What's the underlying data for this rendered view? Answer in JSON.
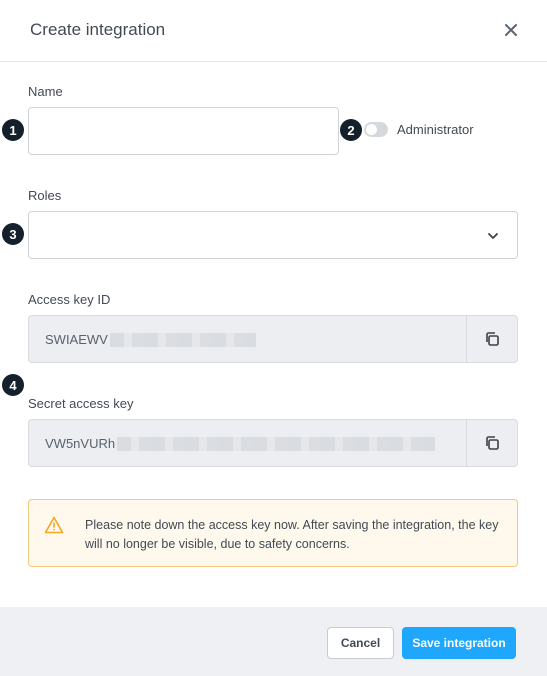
{
  "dialog": {
    "title": "Create integration"
  },
  "fields": {
    "name_label": "Name",
    "name_value": "",
    "admin_label": "Administrator",
    "admin_enabled": false,
    "roles_label": "Roles",
    "roles_value": "",
    "access_key_label": "Access key ID",
    "access_key_value": "SWIAEWV",
    "secret_key_label": "Secret access key",
    "secret_key_value": "VW5nVURh"
  },
  "badges": [
    "1",
    "2",
    "3",
    "4"
  ],
  "warning": {
    "text": "Please note down the access key now. After saving the integration, the key will no longer be visible, due to safety concerns.",
    "icon": "warning-triangle-icon",
    "color": "#f5a623"
  },
  "footer": {
    "cancel_label": "Cancel",
    "save_label": "Save integration"
  },
  "colors": {
    "primary": "#1ea7fd",
    "badge": "#14202b",
    "warning_border": "#f5c97a",
    "warning_bg": "#fff8ec"
  }
}
